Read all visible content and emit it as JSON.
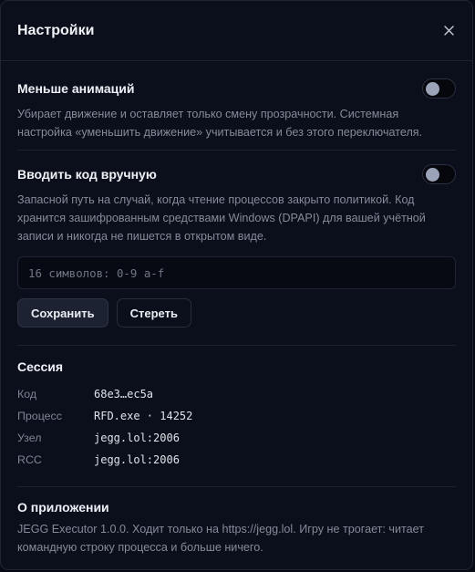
{
  "dialog": {
    "title": "Настройки",
    "close_icon": "close-icon"
  },
  "reduced_motion": {
    "heading": "Меньше анимаций",
    "description": "Убирает движение и оставляет только смену прозрачности. Системная настройка «уменьшить движение» учитывается и без этого переключателя.",
    "enabled": false
  },
  "manual_code": {
    "heading": "Вводить код вручную",
    "description": "Запасной путь на случай, когда чтение процессов закрыто политикой. Код хранится зашифрованным средствами Windows (DPAPI) для вашей учётной записи и никогда не пишется в открытом виде.",
    "enabled": false,
    "input_placeholder": "16 символов: 0-9 a-f",
    "input_value": "",
    "save_label": "Сохранить",
    "clear_label": "Стереть"
  },
  "session": {
    "heading": "Сессия",
    "rows": [
      {
        "key": "Код",
        "value": "68e3…ec5a"
      },
      {
        "key": "Процесс",
        "value": "RFD.exe · 14252"
      },
      {
        "key": "Узел",
        "value": "jegg.lol:2006"
      },
      {
        "key": "RCC",
        "value": "jegg.lol:2006"
      }
    ]
  },
  "about": {
    "heading": "О приложении",
    "description": "JEGG Executor 1.0.0. Ходит только на https://jegg.lol. Игру не трогает: читает командную строку процесса и больше ничего."
  }
}
